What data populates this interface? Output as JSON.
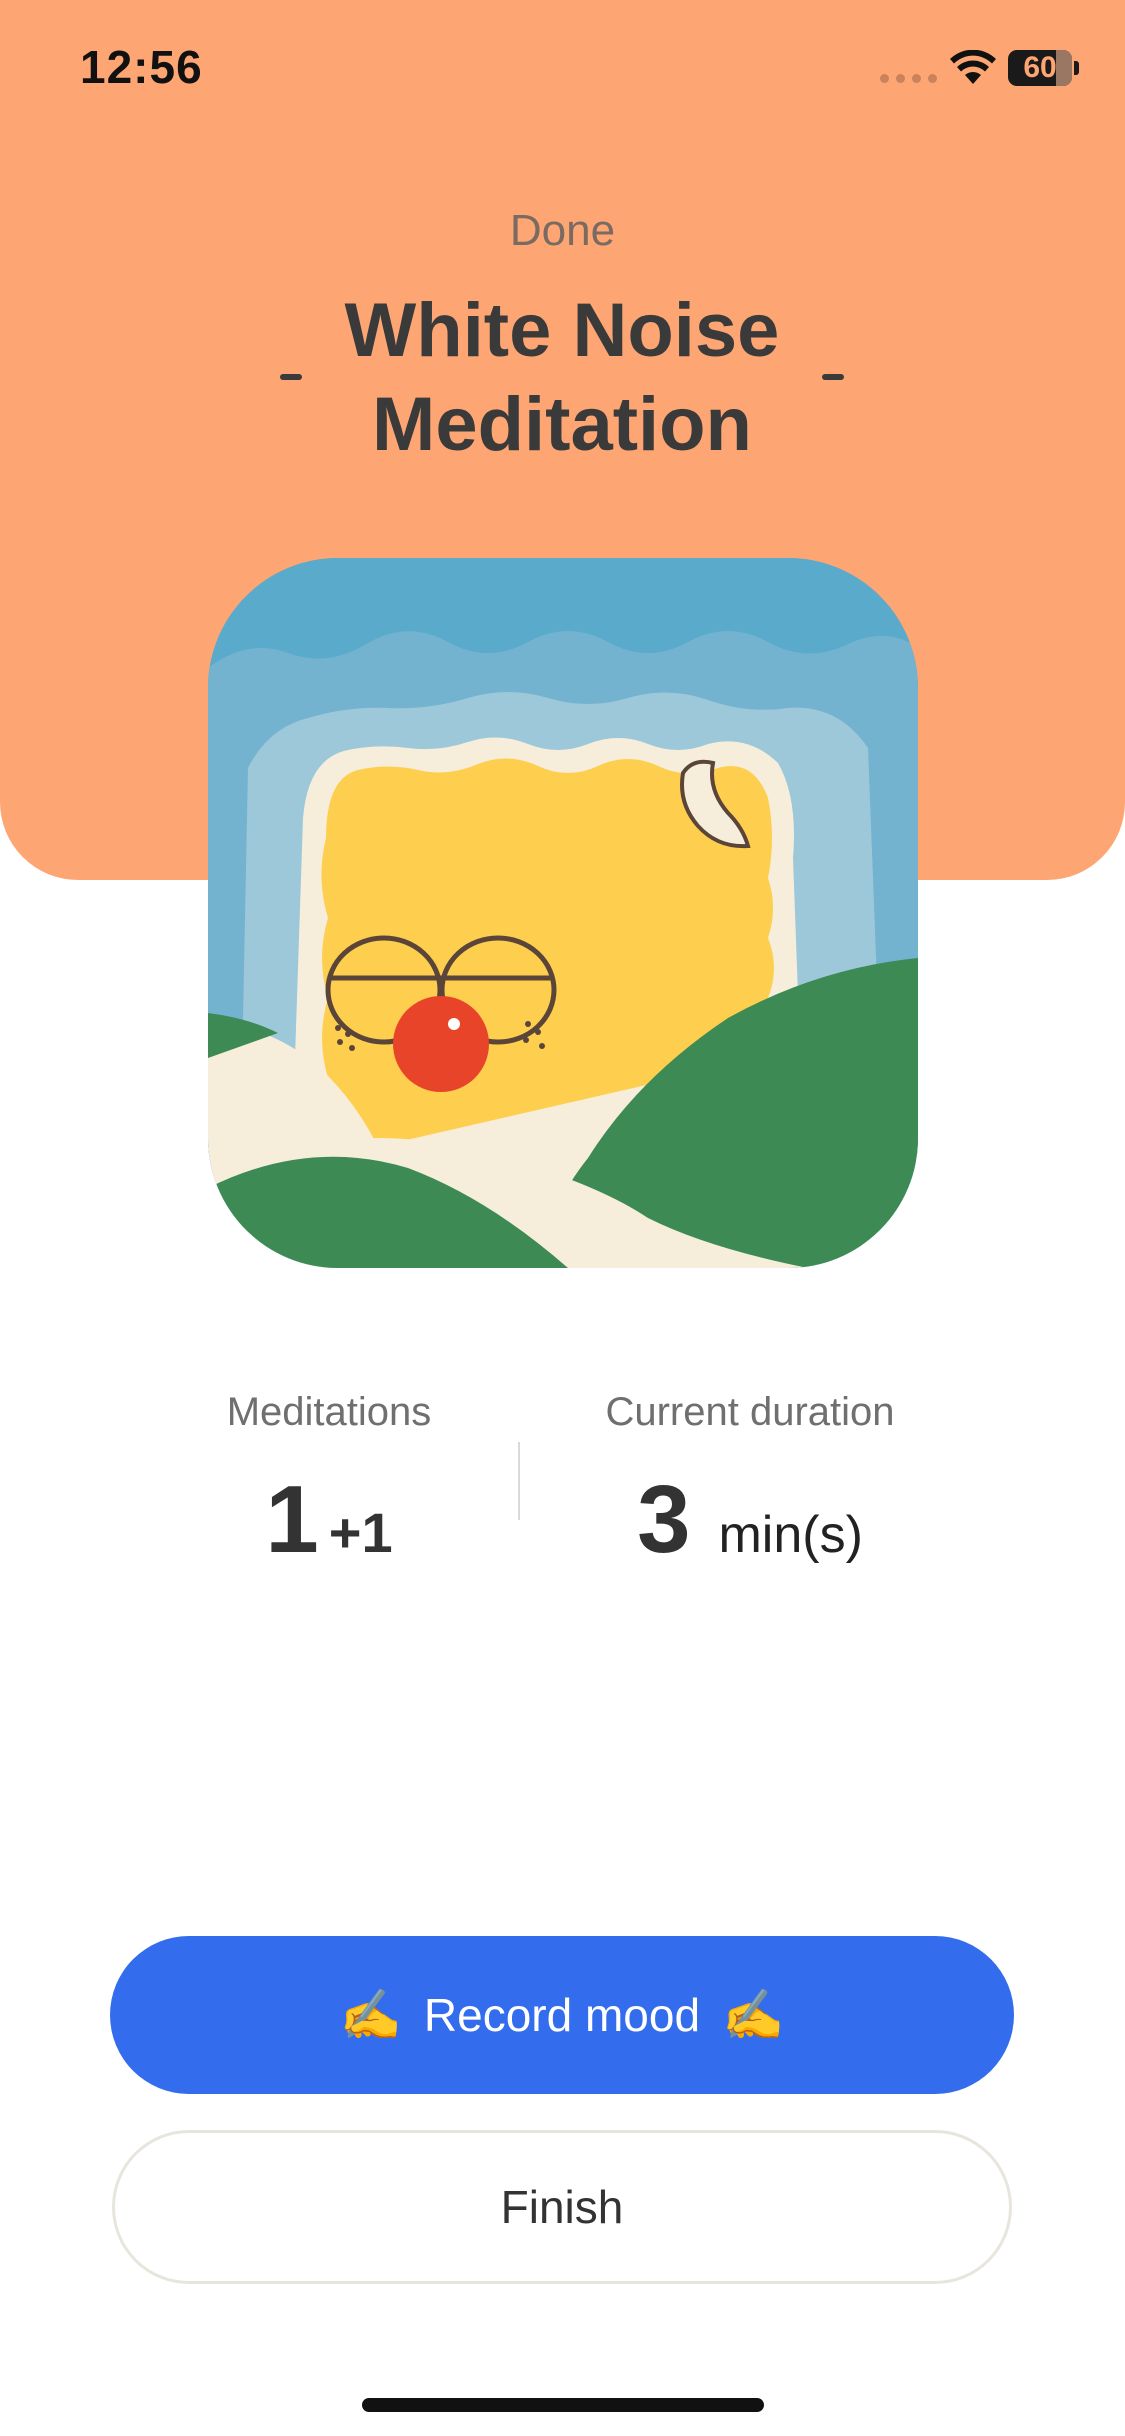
{
  "status_bar": {
    "time": "12:56",
    "battery_level": "60",
    "icons": [
      "signal-dots-icon",
      "wifi-icon",
      "battery-icon"
    ]
  },
  "header": {
    "done_label": "Done",
    "title": "White Noise Meditation",
    "background_color": "#FDA673"
  },
  "artwork": {
    "icon": "sleeping-sun-icon"
  },
  "stats": {
    "meditations": {
      "label": "Meditations",
      "value": "1",
      "delta": "+1"
    },
    "current_duration": {
      "label": "Current duration",
      "value": "3",
      "unit": "min(s)"
    }
  },
  "actions": {
    "record_mood": {
      "label": "Record mood",
      "emoji": "✍️",
      "color": "#336CEC"
    },
    "finish": {
      "label": "Finish"
    }
  }
}
